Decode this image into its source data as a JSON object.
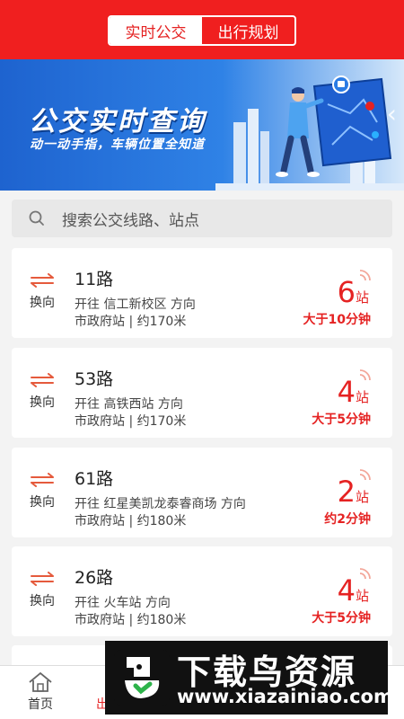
{
  "header": {
    "tabs": [
      {
        "label": "实时公交",
        "active": true
      },
      {
        "label": "出行规划",
        "active": false
      }
    ],
    "color": "#f01f1f"
  },
  "banner": {
    "title": "公交实时查询",
    "subtitle": "动一动手指，车辆位置全知道"
  },
  "search": {
    "placeholder": "搜索公交线路、站点"
  },
  "swap_label": "换向",
  "routes": [
    {
      "name": "11路",
      "direction": "开往 信工新校区 方向",
      "stop": "市政府站 | 约170米",
      "stations": "6",
      "unit": "站",
      "eta": "大于10分钟"
    },
    {
      "name": "53路",
      "direction": "开往 高铁西站 方向",
      "stop": "市政府站 | 约170米",
      "stations": "4",
      "unit": "站",
      "eta": "大于5分钟"
    },
    {
      "name": "61路",
      "direction": "开往 红星美凯龙泰睿商场 方向",
      "stop": "市政府站 | 约180米",
      "stations": "2",
      "unit": "站",
      "eta": "约2分钟"
    },
    {
      "name": "26路",
      "direction": "开往 火车站 方向",
      "stop": "市政府站 | 约180米",
      "stations": "4",
      "unit": "站",
      "eta": "大于5分钟"
    }
  ],
  "tabbar": {
    "items": [
      {
        "label": "首页",
        "icon": "home-icon"
      },
      {
        "label": "出行规划",
        "icon": "route-icon"
      }
    ]
  },
  "watermark": {
    "title": "下载鸟资源",
    "url": "www.xiazainiao.com"
  },
  "accent_color": "#e52222"
}
